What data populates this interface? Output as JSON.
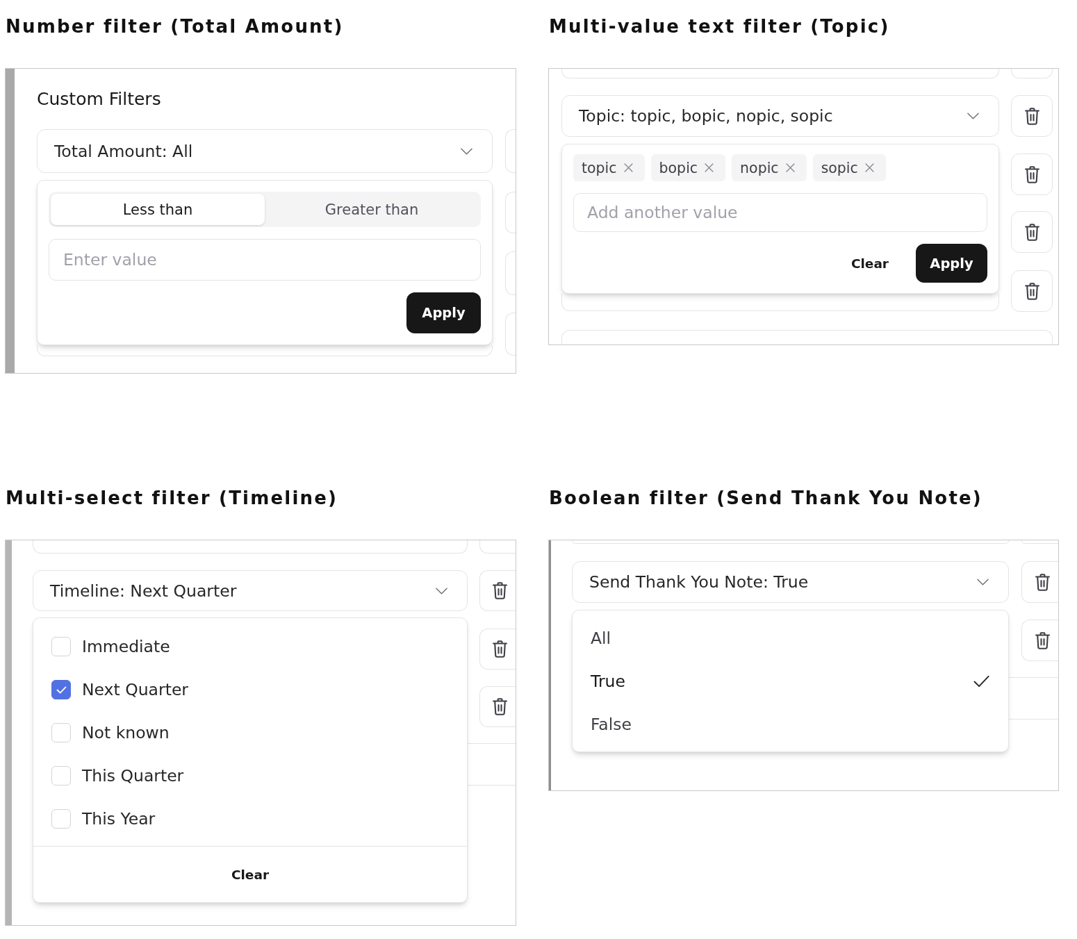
{
  "panels": [
    {
      "kind": "number",
      "caption": "Number filter (Total Amount)",
      "section_title": "Custom Filters",
      "field": {
        "label": "Total Amount: All"
      },
      "operators": [
        {
          "label": "Less than",
          "selected": true
        },
        {
          "label": "Greater than",
          "selected": false
        }
      ],
      "input": {
        "placeholder": "Enter value"
      },
      "buttons": [
        {
          "label": "Apply",
          "kind": "primary"
        }
      ]
    },
    {
      "kind": "multi_value",
      "caption": "Multi-value text filter (Topic)",
      "field": {
        "label": "Topic: topic, bopic, nopic, sopic"
      },
      "chips": [
        "topic",
        "bopic",
        "nopic",
        "sopic"
      ],
      "input": {
        "placeholder": "Add another value"
      },
      "buttons": [
        {
          "label": "Clear",
          "kind": "text"
        },
        {
          "label": "Apply",
          "kind": "primary"
        }
      ]
    },
    {
      "kind": "multi_select",
      "caption": "Multi-select filter (Timeline)",
      "field": {
        "label": "Timeline: Next Quarter"
      },
      "options": [
        {
          "label": "Immediate",
          "checked": false
        },
        {
          "label": "Next Quarter",
          "checked": true
        },
        {
          "label": "Not known",
          "checked": false
        },
        {
          "label": "This Quarter",
          "checked": false
        },
        {
          "label": "This Year",
          "checked": false
        }
      ],
      "buttons": [
        {
          "label": "Clear",
          "kind": "text"
        }
      ]
    },
    {
      "kind": "boolean",
      "caption": "Boolean filter (Send Thank You Note)",
      "field": {
        "label": "Send Thank You Note: True"
      },
      "options": [
        {
          "label": "All",
          "selected": false
        },
        {
          "label": "True",
          "selected": true
        },
        {
          "label": "False",
          "selected": false
        }
      ]
    }
  ]
}
